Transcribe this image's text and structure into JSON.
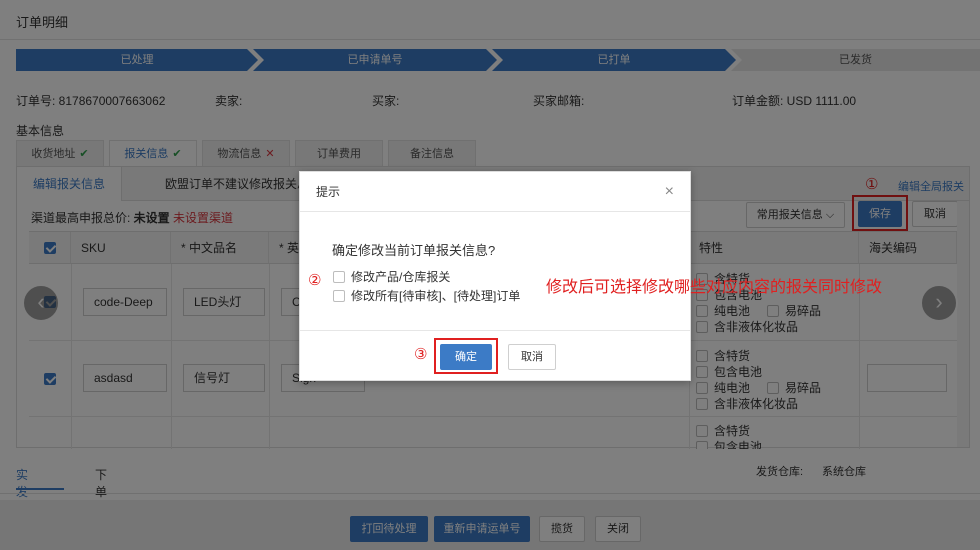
{
  "window": {
    "title": "订单明细"
  },
  "steps": [
    "已处理",
    "已申请单号",
    "已打单",
    "已发货"
  ],
  "order_info": {
    "order_no": "订单号: 8178670007663062",
    "seller": "卖家:",
    "buyer": "买家:",
    "buyer_email": "买家邮箱:",
    "amount": "订单金额: USD 1111.00"
  },
  "section_title": "基本信息",
  "tabs": [
    {
      "label": "收货地址",
      "mark": "✔"
    },
    {
      "label": "报关信息",
      "mark": "✔"
    },
    {
      "label": "物流信息",
      "mark": "✕"
    },
    {
      "label": "订单费用",
      "mark": ""
    },
    {
      "label": "备注信息",
      "mark": ""
    }
  ],
  "panel": {
    "subtab_edit": "编辑报关信息",
    "subtab_eu": "欧盟订单不建议修改报关总",
    "circled_1": "①",
    "edit_global": "编辑全局报关",
    "max_declared_label": "渠道最高申报总价: ",
    "max_declared_value": "未设置",
    "channel_unset": " 未设置渠道",
    "common_info": "常用报关信息",
    "save": "保存",
    "cancel": "取消"
  },
  "table": {
    "headers": [
      "SKU",
      "* 中文品名",
      "* 英文",
      "特性",
      "海关编码"
    ],
    "rows": [
      {
        "sku": "code-Deep",
        "cn_name": "LED头灯",
        "en_name": "Car"
      },
      {
        "sku": "asdasd",
        "cn_name": "信号灯",
        "en_name": "Sign"
      }
    ],
    "attr_options": [
      "含特货",
      "包含电池",
      "纯电池",
      "易碎品",
      "含非液体化妆品"
    ]
  },
  "dialog": {
    "title": "提示",
    "close": "×",
    "question": "确定修改当前订单报关信息?",
    "circled_2": "②",
    "option_1": "修改产品/仓库报关",
    "option_2": "修改所有[待审核]、[待处理]订单",
    "circled_3": "③",
    "confirm": "确定",
    "cancel": "取消"
  },
  "annotation_text": "修改后可选择修改哪些对应内容的报关同时修改",
  "bottom": {
    "tab_actual": "实发商品",
    "tab_order": "下单商品",
    "warehouse_label": "发货仓库:",
    "warehouse_value": "系统仓库"
  },
  "footer_buttons": [
    "打回待处理",
    "重新申请运单号",
    "揽货",
    "关闭"
  ]
}
